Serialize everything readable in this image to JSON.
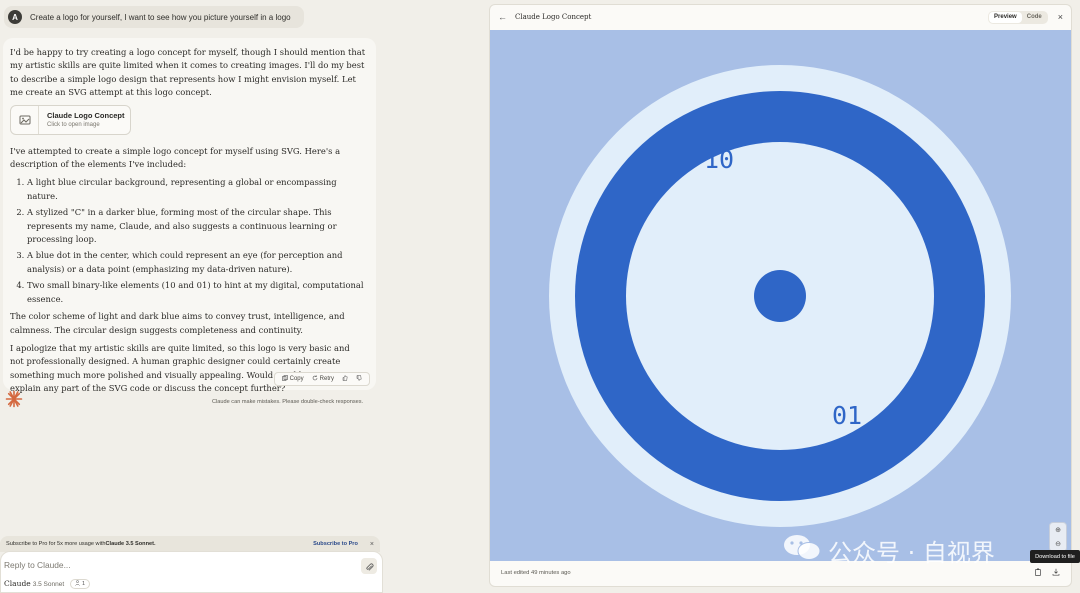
{
  "user_message": {
    "avatar_initial": "A",
    "text": "Create a logo for yourself, I want to see how you picture yourself in a logo"
  },
  "assistant": {
    "intro": "I'd be happy to try creating a logo concept for myself, though I should mention that my artistic skills are quite limited when it comes to creating images. I'll do my best to describe a simple logo design that represents how I might envision myself. Let me create an SVG attempt at this logo concept.",
    "artifact_card": {
      "title": "Claude Logo Concept",
      "subtitle": "Click to open image"
    },
    "elements_intro": "I've attempted to create a simple logo concept for myself using SVG. Here's a description of the elements I've included:",
    "elements": [
      "A light blue circular background, representing a global or encompassing nature.",
      "A stylized \"C\" in a darker blue, forming most of the circular shape. This represents my name, Claude, and also suggests a continuous learning or processing loop.",
      "A blue dot in the center, which could represent an eye (for perception and analysis) or a data point (emphasizing my data-driven nature).",
      "Two small binary-like elements (10 and 01) to hint at my digital, computational essence."
    ],
    "para_colors": "The color scheme of light and dark blue aims to convey trust, intelligence, and calmness. The circular design suggests completeness and continuity.",
    "para_apology": "I apologize that my artistic skills are quite limited, so this logo is very basic and not professionally designed. A human graphic designer could certainly create something much more polished and visually appealing. Would you like me to explain any part of the SVG code or discuss the concept further?",
    "actions": {
      "copy": "Copy",
      "retry": "Retry"
    }
  },
  "disclaimer": "Claude can make mistakes. Please double-check responses.",
  "subscribe": {
    "prefix": "Subscribe to Pro for 5x more usage with ",
    "model": "Claude 3.5 Sonnet.",
    "link": "Subscribe to Pro"
  },
  "composer": {
    "placeholder": "Reply to Claude...",
    "model_name": "Claude",
    "model_version": "3.5 Sonnet",
    "count": "1"
  },
  "panel": {
    "title": "Claude Logo Concept",
    "tab_preview": "Preview",
    "tab_code": "Code",
    "last_edited": "Last edited 49 minutes ago",
    "tooltip": "Download to file"
  },
  "logo": {
    "text_top": "10",
    "text_bottom": "01",
    "colors": {
      "canvas_bg": "#a8bfe6",
      "outer_circle": "#e1eefa",
      "ring": "#2f66c7",
      "inner_circle": "#e1eefa",
      "dot": "#2f66c7",
      "text": "#2f66c7"
    }
  },
  "watermark": "公众号 · 自视界"
}
